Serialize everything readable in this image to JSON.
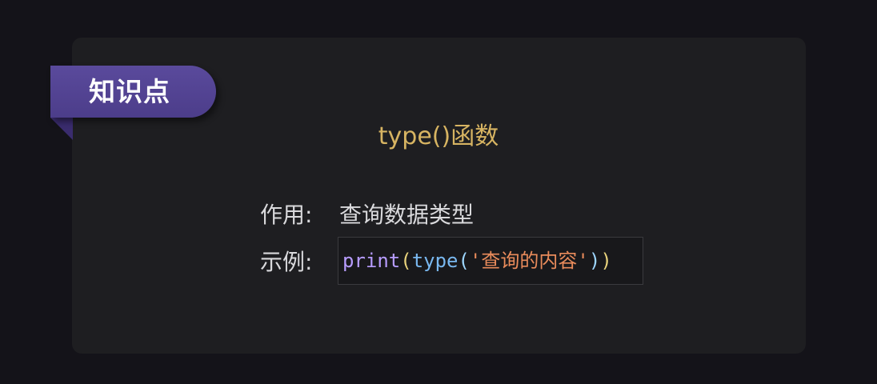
{
  "badge": {
    "label": "知识点"
  },
  "title": "type()函数",
  "rows": {
    "usage": {
      "label": "作用:",
      "value": "查询数据类型"
    },
    "example": {
      "label": "示例:",
      "code": {
        "print": "print",
        "open1": "(",
        "type": "type",
        "open2": "(",
        "string": "'查询的内容'",
        "close2": ")",
        "close1": ")"
      }
    }
  },
  "colors": {
    "background": "#141319",
    "card": "#1e1e21",
    "badge": "#4c3d8a",
    "title": "#d7b462",
    "text": "#d9d9dc",
    "code_function": "#b79cff",
    "code_string": "#e98b5b"
  }
}
